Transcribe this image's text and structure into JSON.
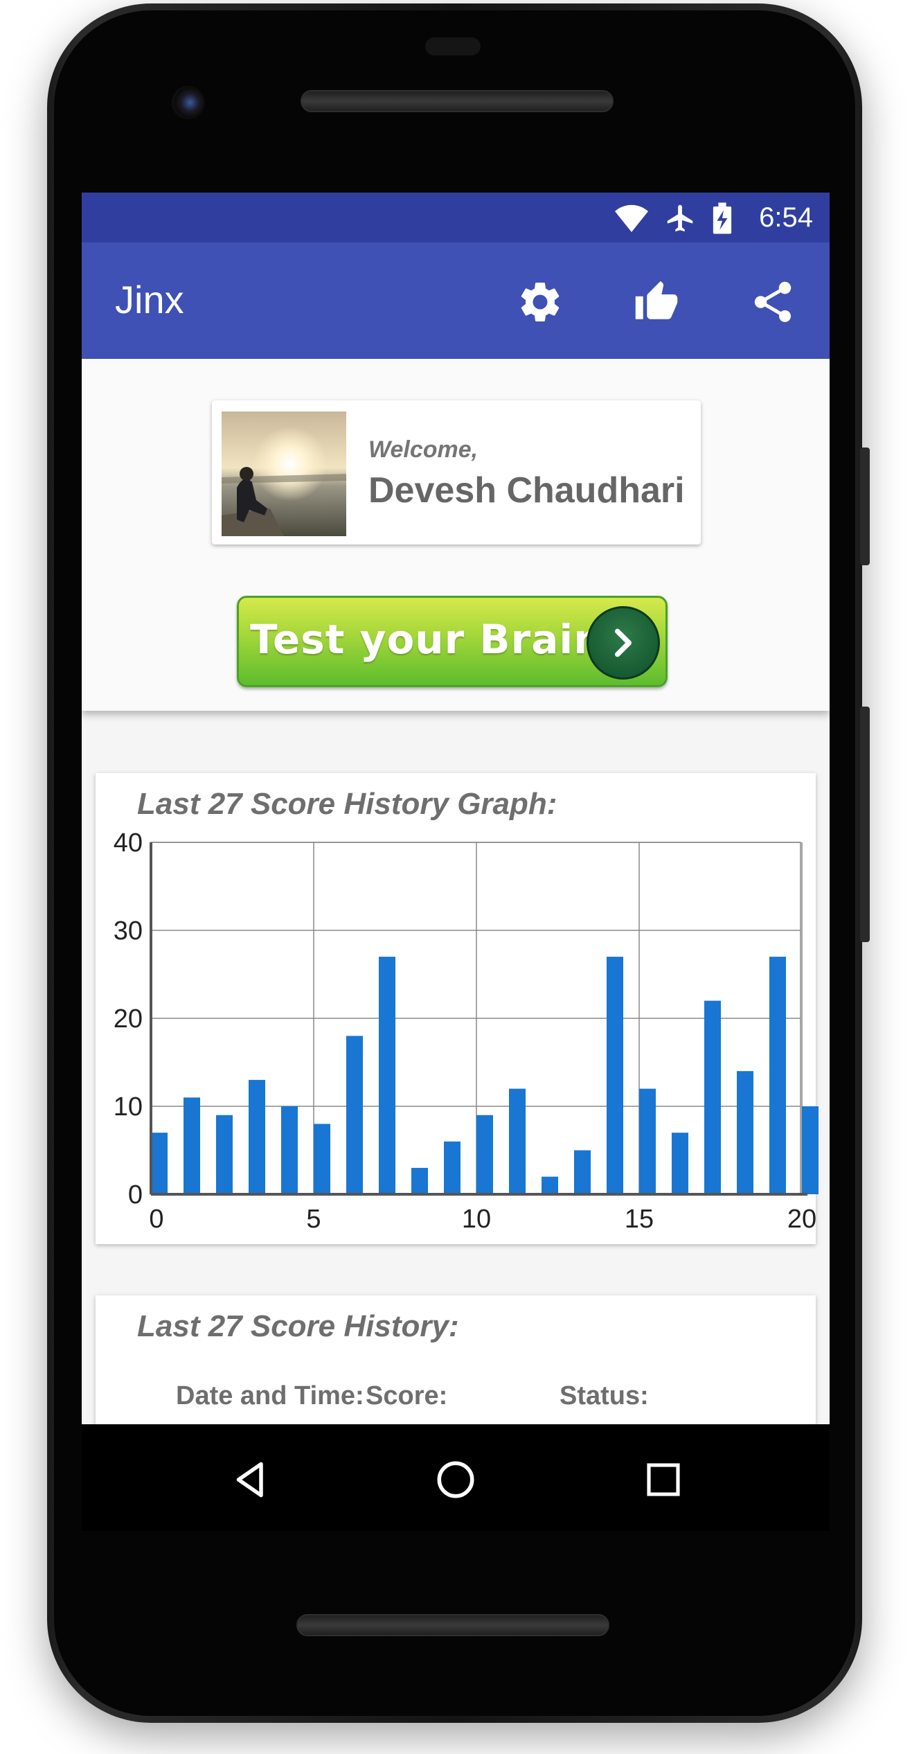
{
  "status_bar": {
    "time": "6:54"
  },
  "app_bar": {
    "title": "Jinx"
  },
  "welcome": {
    "label": "Welcome,",
    "name": "Devesh Chaudhari"
  },
  "test_button": {
    "label": "Test your Brain"
  },
  "graph_card": {
    "title": "Last 27 Score History Graph:"
  },
  "chart_data": {
    "type": "bar",
    "x": [
      0,
      1,
      2,
      3,
      4,
      5,
      6,
      7,
      8,
      9,
      10,
      11,
      12,
      13,
      14,
      15,
      16,
      17,
      18,
      19,
      20
    ],
    "values": [
      7,
      11,
      9,
      13,
      10,
      8,
      18,
      27,
      3,
      6,
      9,
      12,
      2,
      5,
      27,
      12,
      7,
      22,
      14,
      27,
      10
    ],
    "x_ticks": [
      "0",
      "5",
      "10",
      "15",
      "20"
    ],
    "y_ticks": [
      "0",
      "10",
      "20",
      "30",
      "40"
    ],
    "ylim": [
      0,
      40
    ],
    "xlim": [
      0,
      20
    ],
    "bar_color": "#1976d2",
    "grid": true
  },
  "history_card": {
    "title": "Last 27 Score History:",
    "columns": [
      "Date and Time:",
      "Score:",
      "Status:"
    ]
  },
  "colors": {
    "status_bar": "#303f9f",
    "app_bar": "#3f51b5",
    "bar": "#1976d2"
  }
}
